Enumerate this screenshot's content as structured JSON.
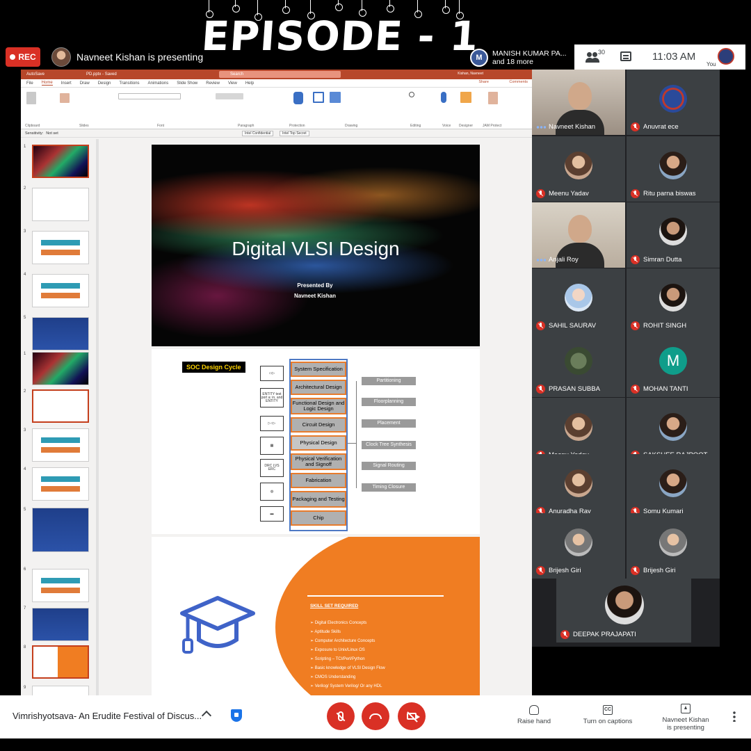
{
  "banner": {
    "title": "EPISODE - 1"
  },
  "topbar": {
    "rec_label": "REC",
    "presenting_text": "Navneet Kishan is presenting",
    "chip_name": "MANISH KUMAR PA...",
    "chip_more": "and 18 more",
    "people_count": "30",
    "clock": "11:03 AM",
    "you_label": "You"
  },
  "ppt": {
    "autosave": "AutoSave",
    "filename": "PD.pptx - Saved",
    "search": "Search",
    "user": "Kishan, Navneet",
    "tabs": [
      "File",
      "Home",
      "Insert",
      "Draw",
      "Design",
      "Transitions",
      "Animations",
      "Slide Show",
      "Review",
      "View",
      "Help"
    ],
    "share": "Share",
    "comments": "Comments",
    "groups": [
      "Clipboard",
      "Slides",
      "Font",
      "Paragraph",
      "Protection",
      "Drawing",
      "Editing",
      "Voice",
      "Designer",
      "JAM Protect"
    ],
    "sensitivity_label": "Sensitivity:",
    "sensitivity_value": "Not set",
    "tag1": "Intel Confidential",
    "tag2": "Intel Top Secret",
    "thumb_numbers": [
      "1",
      "2",
      "3",
      "4",
      "5",
      "1",
      "2",
      "3",
      "4",
      "5",
      "6",
      "7",
      "8",
      "9"
    ]
  },
  "slide1": {
    "title": "Digital VLSI Design",
    "presented_by": "Presented By",
    "presenter": "Navneet Kishan"
  },
  "slide2": {
    "label": "SOC Design Cycle",
    "steps": [
      "System Specification",
      "Architectural Design",
      "Functional Design and Logic Design",
      "Circuit Design",
      "Physical Design",
      "Physical Verification and Signoff",
      "Fabrication",
      "Packaging and Testing",
      "Chip"
    ],
    "icon_texts": [
      "ENTITY test port a: in, and ENTITY",
      "DRC LVS ERC"
    ],
    "physical_steps": [
      "Partitioning",
      "Floorplanning",
      "Placement",
      "Clock Tree Synthesis",
      "Signal Routing",
      "Timing Closure"
    ]
  },
  "slide3": {
    "heading": "SKILL SET REQUIRED",
    "items": [
      "Digital Electronics Concepts",
      "Aptitude Skills",
      "Computer Architecture Concepts",
      "Exposure to Unix/Linux OS",
      "Scripting – TCl/Perl/Python",
      "Basic knowledge of VLSI Design Flow",
      "CMOS Understanding",
      "Verilog/ System Verilog/ Or any HDL"
    ]
  },
  "participants": [
    {
      "name": "Navneet Kishan",
      "kind": "video",
      "muted": false
    },
    {
      "name": "Anuvrat ece",
      "kind": "logo",
      "muted": true
    },
    {
      "name": "Meenu Yadav",
      "kind": "photo",
      "muted": true
    },
    {
      "name": "Ritu parna biswas",
      "kind": "photo2",
      "muted": true
    },
    {
      "name": "Anjali Roy",
      "kind": "video",
      "muted": false
    },
    {
      "name": "Simran Dutta",
      "kind": "photo3",
      "muted": true
    },
    {
      "name": "SAHIL SAURAV",
      "kind": "anime",
      "muted": true
    },
    {
      "name": "ROHIT SINGH",
      "kind": "photo3",
      "muted": true
    },
    {
      "name": "PRASAN SUBBA",
      "kind": "green",
      "muted": true
    },
    {
      "name": "MOHAN TANTI",
      "kind": "letter",
      "letter": "M",
      "muted": true
    },
    {
      "name": "Meenu Yadav",
      "kind": "photo",
      "muted": true
    },
    {
      "name": "SAKSHEE RAJPOOT",
      "kind": "photo2",
      "muted": true
    },
    {
      "name": "Anuradha Ray",
      "kind": "photo",
      "muted": true
    },
    {
      "name": "Somu Kumari",
      "kind": "photo2",
      "muted": true
    },
    {
      "name": "Brijesh Giri",
      "kind": "photo4",
      "muted": true
    },
    {
      "name": "Brijesh Giri",
      "kind": "photo4",
      "muted": true
    },
    {
      "name": "DEEPAK PRAJAPATI",
      "kind": "photo3",
      "muted": true
    }
  ],
  "bottombar": {
    "meeting_title": "Vimrishyotsava- An Erudite Festival of Discus...",
    "raise_hand": "Raise hand",
    "captions": "Turn on captions",
    "presenting_line1": "Navneet Kishan",
    "presenting_line2": "is presenting"
  },
  "colors": {
    "record": "#d93025",
    "ppt_brand": "#b7472a",
    "tile_bg": "#3c4043",
    "slide_orange": "#f07d22"
  }
}
